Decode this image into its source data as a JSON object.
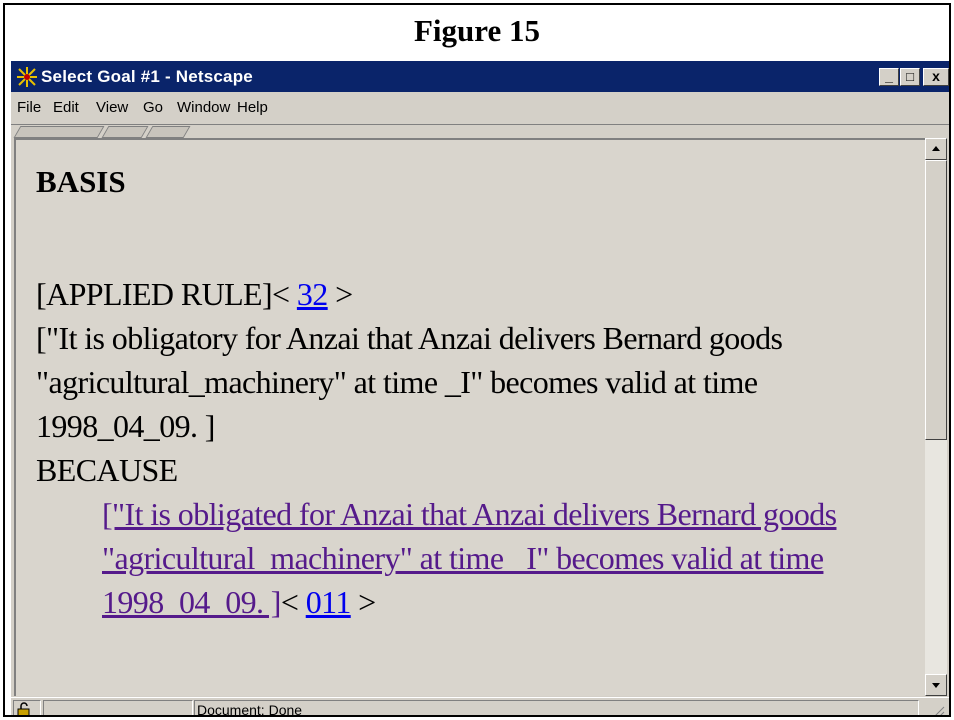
{
  "figure": {
    "title": "Figure 15"
  },
  "window": {
    "title": "Select Goal #1 - Netscape",
    "controls": {
      "minimize": "_",
      "maximize": "□",
      "close": "x"
    }
  },
  "menu": {
    "file": "File",
    "edit": "Edit",
    "view": "View",
    "go": "Go",
    "window": "Window",
    "help": "Help"
  },
  "document": {
    "heading": "BASIS",
    "applied_rule_label": "[APPLIED RULE]< ",
    "applied_rule_link": "32",
    "applied_rule_close": " >",
    "rule_text_line1": "[\"It is obligatory for Anzai that Anzai delivers Bernard goods",
    "rule_text_line2": "\"agricultural_machinery\" at time _I\" becomes valid at time",
    "rule_text_line3": "1998_04_09. ]",
    "because": "BECAUSE",
    "reason_link_line1": "[\"It is obligated for Anzai that Anzai delivers Bernard goods",
    "reason_link_line2": "\"agricultural_machinery\" at time _I\" becomes valid at time",
    "reason_link_line3": "1998_04_09. ]",
    "reason_ref_open": "< ",
    "reason_ref_link": "011",
    "reason_ref_close": " >"
  },
  "status": {
    "text": "Document: Done"
  },
  "colors": {
    "titlebar": "#0a246a",
    "link": "#0000ee",
    "visited_link": "#551a8b",
    "content_bg": "#d9d5cd"
  }
}
